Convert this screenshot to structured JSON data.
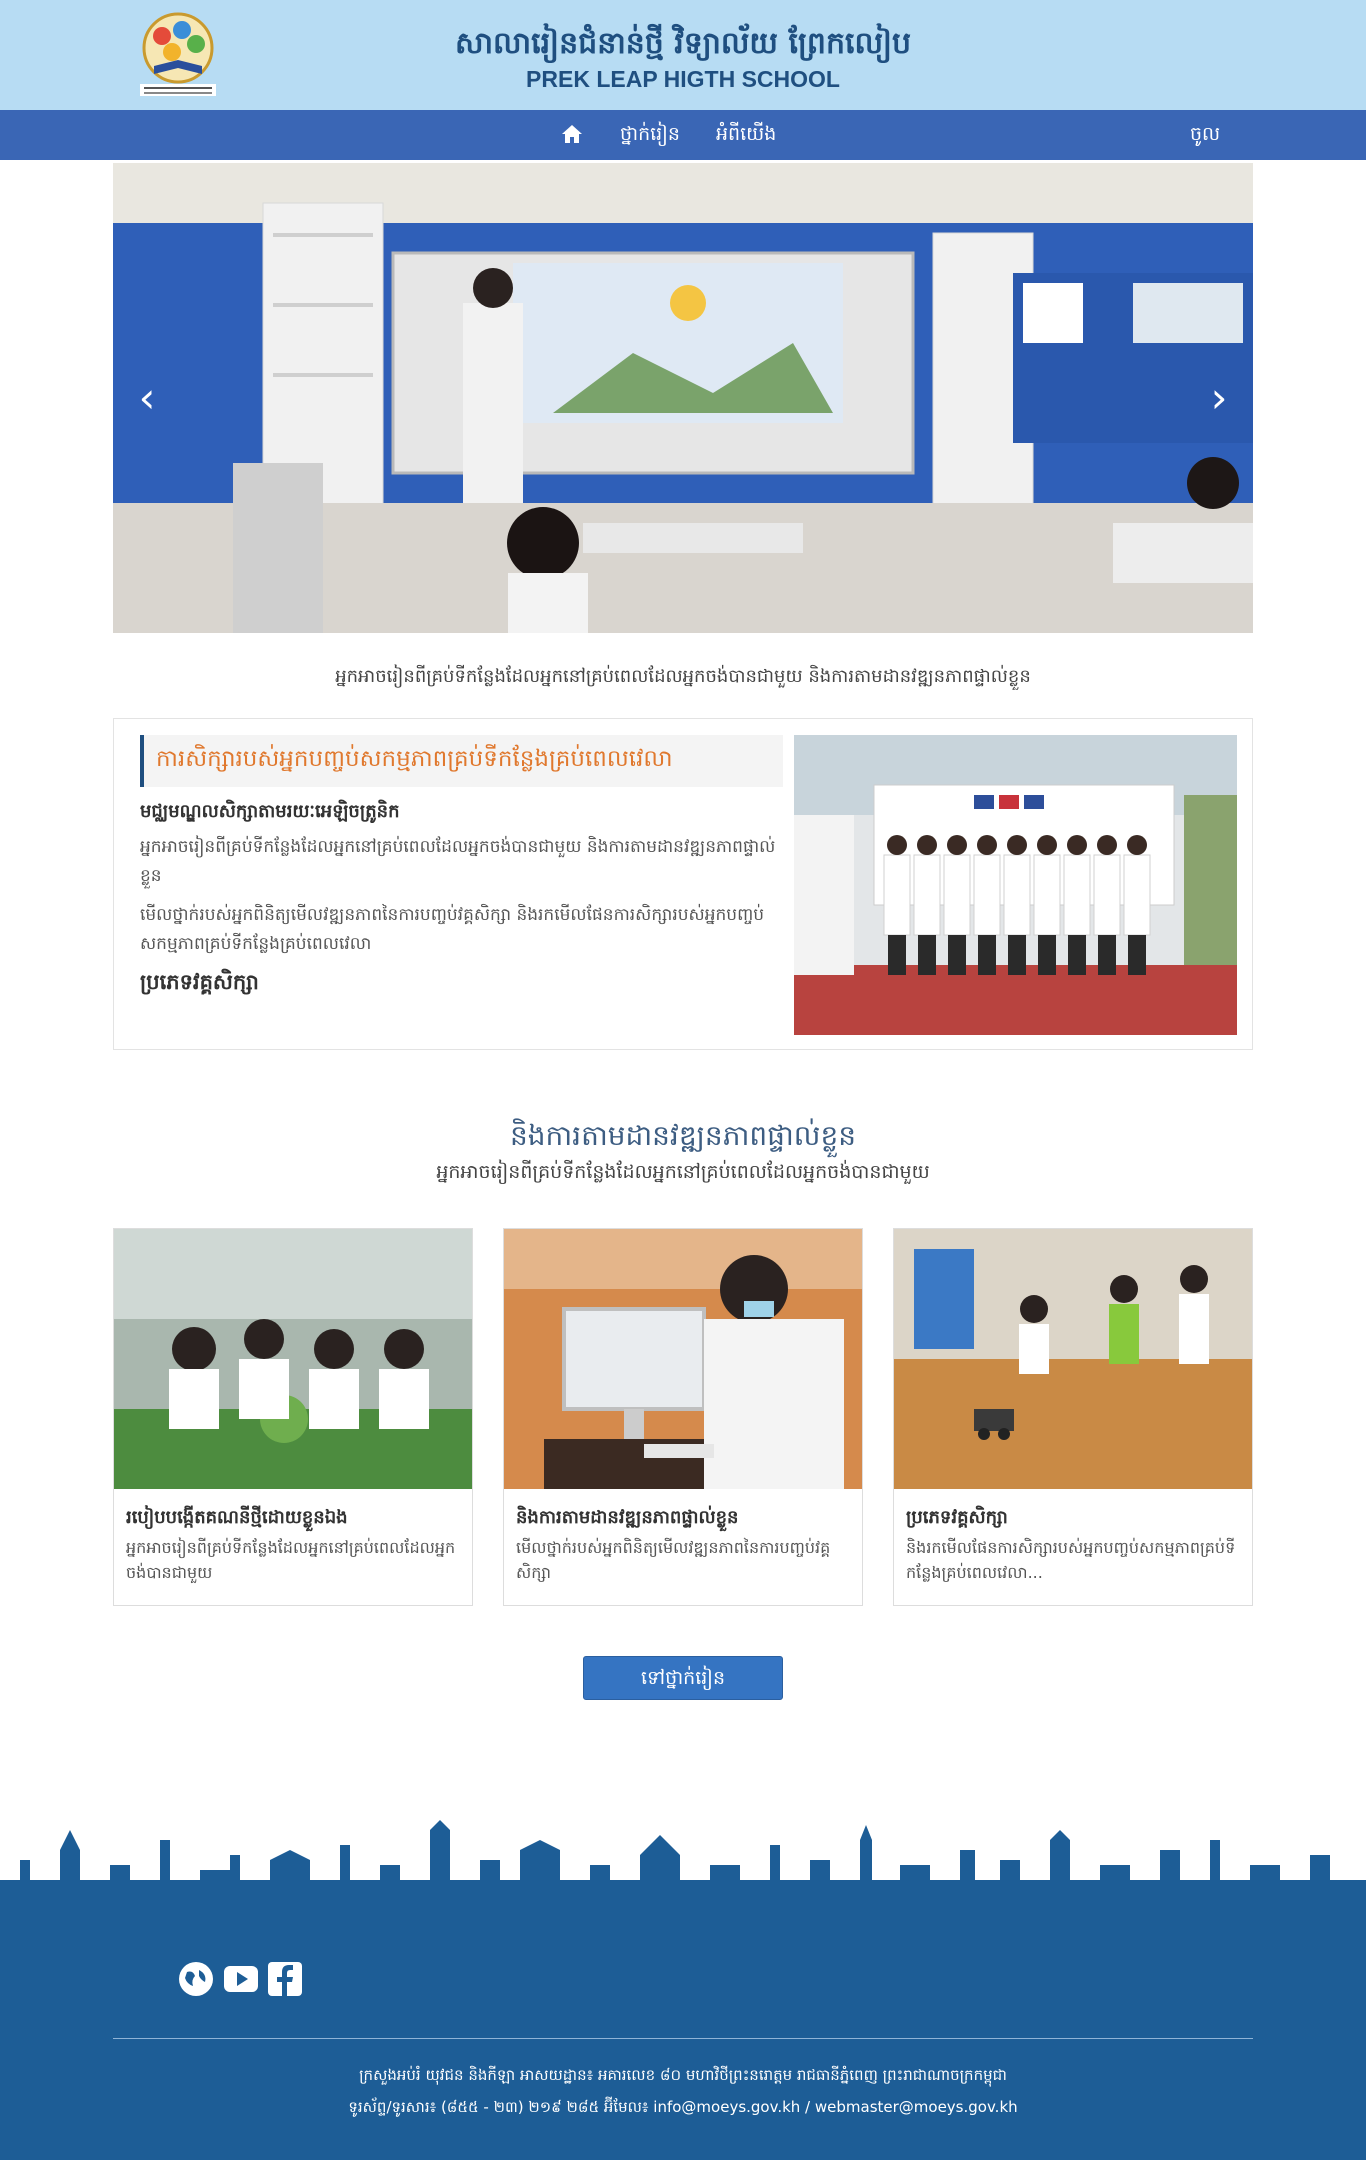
{
  "header": {
    "school_name_kh": "សាលារៀនជំនាន់ថ្មី វិទ្យាល័យ ព្រែកលៀប",
    "school_name_en": "PREK LEAP HIGTH SCHOOL",
    "logo_text": "វិទ្យាល័យ ព្រែកលៀប PREK LEAP HIGH SCHOOL"
  },
  "nav": {
    "home_icon": "home-icon",
    "items": [
      "ថ្នាក់រៀន",
      "អំពីយើង"
    ],
    "login": "ចូល"
  },
  "carousel": {
    "prev_icon": "chevron-left-icon",
    "next_icon": "chevron-right-icon",
    "caption": "អ្នកអាចរៀនពីគ្រប់ទីកន្លែងដែលអ្នកនៅគ្រប់ពេលដែលអ្នកចង់បានជាមួយ និងការតាមដានវឌ្ឍនភាពផ្ទាល់ខ្លួន"
  },
  "feature": {
    "heading": "ការសិក្សារបស់អ្នកបញ្ចប់សកម្មភាពគ្រប់ទីកន្លែងគ្រប់ពេលវេលា",
    "subheading": "មជ្ឈមណ្ឌលសិក្សាតាមរយៈអេឡិចត្រូនិក",
    "para1": "អ្នកអាចរៀនពីគ្រប់ទីកន្លែងដែលអ្នកនៅគ្រប់ពេលដែលអ្នកចង់បានជាមួយ និងការតាមដានវឌ្ឍនភាពផ្ទាល់ខ្លួន",
    "para2": "មើលថ្នាក់របស់អ្នកពិនិត្យមើលវឌ្ឍនភាពនៃការបញ្ចប់វគ្គសិក្សា និងរកមើលផែនការសិក្សារបស់អ្នកបញ្ចប់សកម្មភាពគ្រប់ទីកន្លែងគ្រប់ពេលវេលា",
    "link_heading": "ប្រភេទវគ្គសិក្សា"
  },
  "section": {
    "title": "និងការតាមដានវឌ្ឍនភាពផ្ទាល់ខ្លួន",
    "subtitle": "អ្នកអាចរៀនពីគ្រប់ទីកន្លែងដែលអ្នកនៅគ្រប់ពេលដែលអ្នកចង់បានជាមួយ"
  },
  "cards": [
    {
      "title": "របៀបបង្កើតគណនីថ្មីដោយខ្លួនឯង",
      "text": "អ្នកអាចរៀនពីគ្រប់ទីកន្លែងដែលអ្នកនៅគ្រប់ពេលដែលអ្នកចង់បានជាមួយ"
    },
    {
      "title": "និងការតាមដានវឌ្ឍនភាពផ្ទាល់ខ្លួន",
      "text": "មើលថ្នាក់របស់អ្នកពិនិត្យមើលវឌ្ឍនភាពនៃការបញ្ចប់វគ្គសិក្សា"
    },
    {
      "title": "ប្រភេទវគ្គសិក្សា",
      "text": " និងរកមើលផែនការសិក្សារបស់អ្នកបញ្ចប់សកម្មភាពគ្រប់ទីកន្លែងគ្រប់ពេលវេលា..."
    }
  ],
  "more_button": "ទៅថ្នាក់រៀន",
  "footer": {
    "social_icons": [
      "globe-icon",
      "youtube-icon",
      "facebook-icon"
    ],
    "line1": "ក្រសួងអប់រំ យុវជន និងកីឡា អាសយដ្ឋាន៖ អគារលេខ ៨០ មហាវិថីព្រះនរោត្តម រាជធានីភ្នំពេញ ព្រះរាជាណាចក្រកម្ពុជា",
    "line2": "ទូរស័ព្ទ/ទូរសារ៖ (៨៥៥ - ២៣) ២១៩ ២៨៥ អ៊ីមែល៖ info@moeys.gov.kh / webmaster@moeys.gov.kh"
  },
  "colors": {
    "header_bg": "#b7dcf3",
    "nav_bg": "#3a66b5",
    "title_color": "#1f4f80",
    "accent_orange": "#e0782d",
    "button_bg": "#3574c2",
    "footer_bg": "#1d5d96"
  }
}
